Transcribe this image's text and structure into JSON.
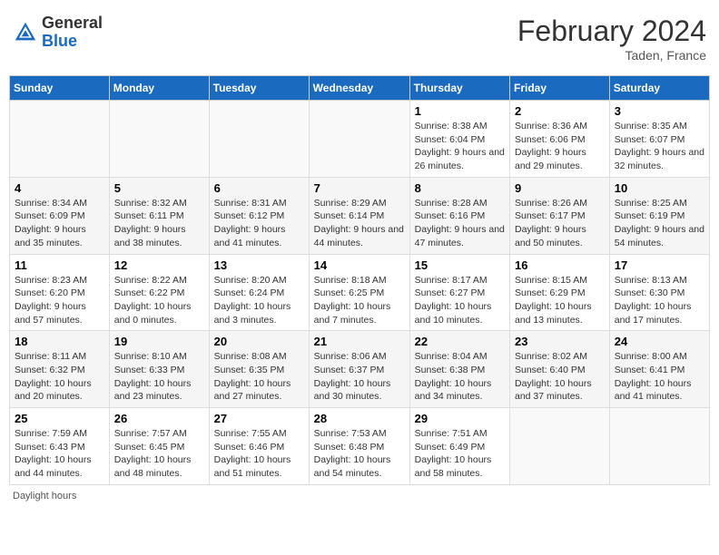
{
  "header": {
    "logo_general": "General",
    "logo_blue": "Blue",
    "month_year": "February 2024",
    "location": "Taden, France"
  },
  "days_of_week": [
    "Sunday",
    "Monday",
    "Tuesday",
    "Wednesday",
    "Thursday",
    "Friday",
    "Saturday"
  ],
  "weeks": [
    [
      {
        "num": "",
        "info": ""
      },
      {
        "num": "",
        "info": ""
      },
      {
        "num": "",
        "info": ""
      },
      {
        "num": "",
        "info": ""
      },
      {
        "num": "1",
        "info": "Sunrise: 8:38 AM\nSunset: 6:04 PM\nDaylight: 9 hours and 26 minutes."
      },
      {
        "num": "2",
        "info": "Sunrise: 8:36 AM\nSunset: 6:06 PM\nDaylight: 9 hours and 29 minutes."
      },
      {
        "num": "3",
        "info": "Sunrise: 8:35 AM\nSunset: 6:07 PM\nDaylight: 9 hours and 32 minutes."
      }
    ],
    [
      {
        "num": "4",
        "info": "Sunrise: 8:34 AM\nSunset: 6:09 PM\nDaylight: 9 hours and 35 minutes."
      },
      {
        "num": "5",
        "info": "Sunrise: 8:32 AM\nSunset: 6:11 PM\nDaylight: 9 hours and 38 minutes."
      },
      {
        "num": "6",
        "info": "Sunrise: 8:31 AM\nSunset: 6:12 PM\nDaylight: 9 hours and 41 minutes."
      },
      {
        "num": "7",
        "info": "Sunrise: 8:29 AM\nSunset: 6:14 PM\nDaylight: 9 hours and 44 minutes."
      },
      {
        "num": "8",
        "info": "Sunrise: 8:28 AM\nSunset: 6:16 PM\nDaylight: 9 hours and 47 minutes."
      },
      {
        "num": "9",
        "info": "Sunrise: 8:26 AM\nSunset: 6:17 PM\nDaylight: 9 hours and 50 minutes."
      },
      {
        "num": "10",
        "info": "Sunrise: 8:25 AM\nSunset: 6:19 PM\nDaylight: 9 hours and 54 minutes."
      }
    ],
    [
      {
        "num": "11",
        "info": "Sunrise: 8:23 AM\nSunset: 6:20 PM\nDaylight: 9 hours and 57 minutes."
      },
      {
        "num": "12",
        "info": "Sunrise: 8:22 AM\nSunset: 6:22 PM\nDaylight: 10 hours and 0 minutes."
      },
      {
        "num": "13",
        "info": "Sunrise: 8:20 AM\nSunset: 6:24 PM\nDaylight: 10 hours and 3 minutes."
      },
      {
        "num": "14",
        "info": "Sunrise: 8:18 AM\nSunset: 6:25 PM\nDaylight: 10 hours and 7 minutes."
      },
      {
        "num": "15",
        "info": "Sunrise: 8:17 AM\nSunset: 6:27 PM\nDaylight: 10 hours and 10 minutes."
      },
      {
        "num": "16",
        "info": "Sunrise: 8:15 AM\nSunset: 6:29 PM\nDaylight: 10 hours and 13 minutes."
      },
      {
        "num": "17",
        "info": "Sunrise: 8:13 AM\nSunset: 6:30 PM\nDaylight: 10 hours and 17 minutes."
      }
    ],
    [
      {
        "num": "18",
        "info": "Sunrise: 8:11 AM\nSunset: 6:32 PM\nDaylight: 10 hours and 20 minutes."
      },
      {
        "num": "19",
        "info": "Sunrise: 8:10 AM\nSunset: 6:33 PM\nDaylight: 10 hours and 23 minutes."
      },
      {
        "num": "20",
        "info": "Sunrise: 8:08 AM\nSunset: 6:35 PM\nDaylight: 10 hours and 27 minutes."
      },
      {
        "num": "21",
        "info": "Sunrise: 8:06 AM\nSunset: 6:37 PM\nDaylight: 10 hours and 30 minutes."
      },
      {
        "num": "22",
        "info": "Sunrise: 8:04 AM\nSunset: 6:38 PM\nDaylight: 10 hours and 34 minutes."
      },
      {
        "num": "23",
        "info": "Sunrise: 8:02 AM\nSunset: 6:40 PM\nDaylight: 10 hours and 37 minutes."
      },
      {
        "num": "24",
        "info": "Sunrise: 8:00 AM\nSunset: 6:41 PM\nDaylight: 10 hours and 41 minutes."
      }
    ],
    [
      {
        "num": "25",
        "info": "Sunrise: 7:59 AM\nSunset: 6:43 PM\nDaylight: 10 hours and 44 minutes."
      },
      {
        "num": "26",
        "info": "Sunrise: 7:57 AM\nSunset: 6:45 PM\nDaylight: 10 hours and 48 minutes."
      },
      {
        "num": "27",
        "info": "Sunrise: 7:55 AM\nSunset: 6:46 PM\nDaylight: 10 hours and 51 minutes."
      },
      {
        "num": "28",
        "info": "Sunrise: 7:53 AM\nSunset: 6:48 PM\nDaylight: 10 hours and 54 minutes."
      },
      {
        "num": "29",
        "info": "Sunrise: 7:51 AM\nSunset: 6:49 PM\nDaylight: 10 hours and 58 minutes."
      },
      {
        "num": "",
        "info": ""
      },
      {
        "num": "",
        "info": ""
      }
    ]
  ],
  "footer": {
    "daylight_hours_label": "Daylight hours"
  }
}
